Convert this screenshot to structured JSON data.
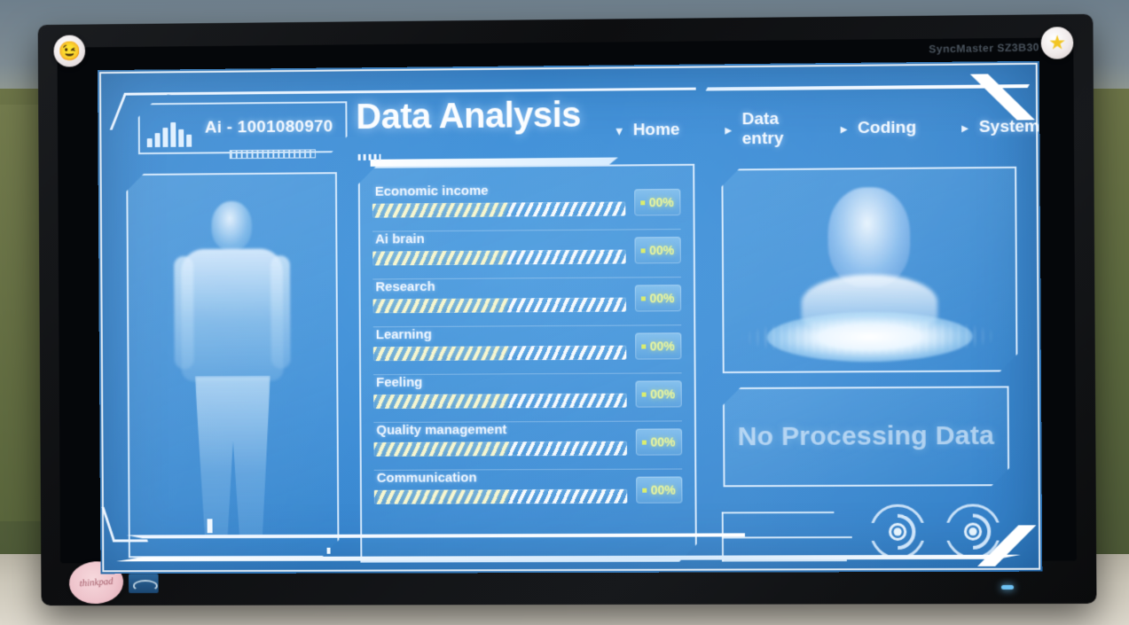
{
  "hardware": {
    "monitor_brand": "SyncMaster SZ3B30",
    "stickers": {
      "smiley": "😉",
      "star": "★",
      "handwritten_note": "thinkpad"
    }
  },
  "header": {
    "id_badge": "Ai - 1001080970",
    "id_badge_icon": "bar-chart-icon",
    "title": "Data Analysis",
    "nav": [
      {
        "label": "Home",
        "arrow": "▼",
        "icon": "chevron-down-icon",
        "active": true
      },
      {
        "label": "Data entry",
        "arrow": "►",
        "icon": "chevron-right-icon",
        "active": false
      },
      {
        "label": "Coding",
        "arrow": "►",
        "icon": "chevron-right-icon",
        "active": false
      },
      {
        "label": "System",
        "arrow": "►",
        "icon": "chevron-right-icon",
        "active": false
      }
    ]
  },
  "left_panel": {
    "name": "body-scan-panel",
    "subject": "full-body-silhouette"
  },
  "metrics_panel": {
    "items": [
      {
        "label": "Economic income",
        "value": "00%",
        "fill_percent": 53
      },
      {
        "label": "Ai brain",
        "value": "00%",
        "fill_percent": 53
      },
      {
        "label": "Research",
        "value": "00%",
        "fill_percent": 53
      },
      {
        "label": "Learning",
        "value": "00%",
        "fill_percent": 53
      },
      {
        "label": "Feeling",
        "value": "00%",
        "fill_percent": 53
      },
      {
        "label": "Quality management",
        "value": "00%",
        "fill_percent": 53
      },
      {
        "label": "Communication",
        "value": "00%",
        "fill_percent": 53
      }
    ]
  },
  "right_panel": {
    "hologram": "holographic-head-projection",
    "status_message": "No Processing Data",
    "dials": [
      {
        "name": "radar-dial-left"
      },
      {
        "name": "radar-dial-right"
      }
    ]
  },
  "colors": {
    "screen_blue": "#3f8ed6",
    "accent_white": "#eaf4ff",
    "value_yellow": "#e9f59a",
    "chip_dot_green": "#d9ec6a",
    "bar_fill": "#f6f6cf"
  },
  "chart_data": {
    "type": "bar",
    "title": "Data Analysis",
    "categories": [
      "Economic income",
      "Ai brain",
      "Research",
      "Learning",
      "Feeling",
      "Quality management",
      "Communication"
    ],
    "values": [
      53,
      53,
      53,
      53,
      53,
      53,
      53
    ],
    "labels": [
      "00%",
      "00%",
      "00%",
      "00%",
      "00%",
      "00%",
      "00%"
    ],
    "xlabel": "",
    "ylabel": "",
    "ylim": [
      0,
      100
    ],
    "grid": false,
    "legend": "none",
    "orientation": "horizontal"
  }
}
